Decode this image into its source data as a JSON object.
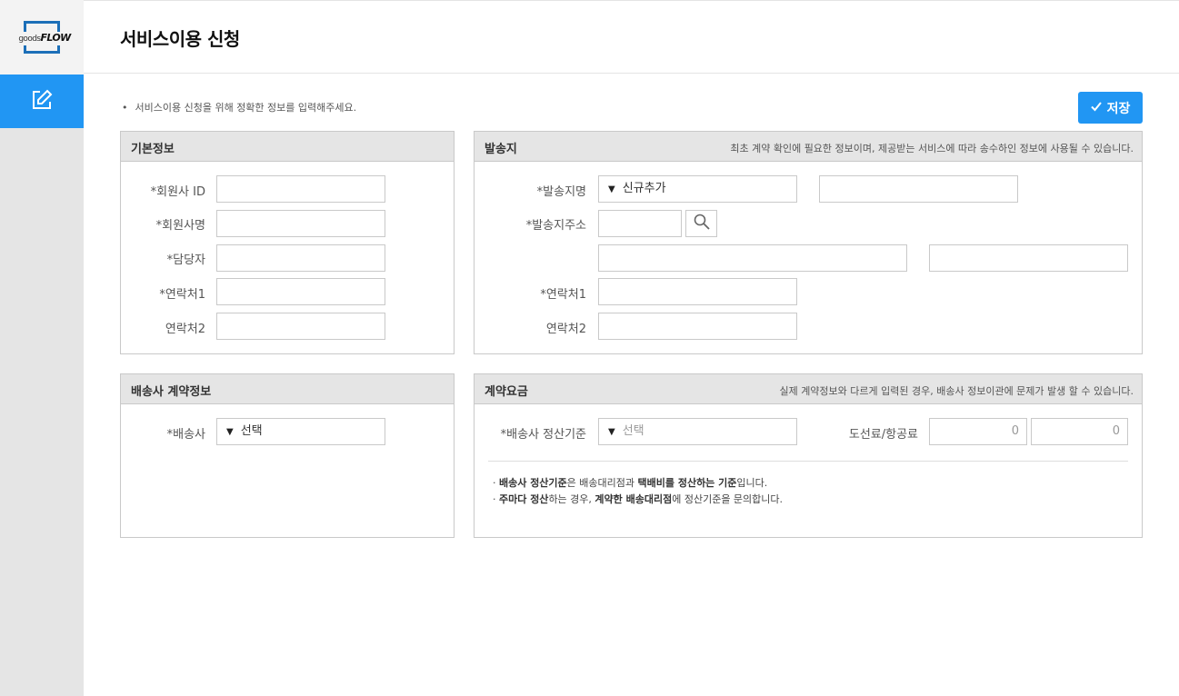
{
  "logo": {
    "prefix": "goods",
    "name": "FLOW"
  },
  "header": {
    "title": "서비스이용 신청"
  },
  "notice": "서비스이용 신청을 위해 정확한 정보를 입력해주세요.",
  "toolbar": {
    "save_label": "저장"
  },
  "basic": {
    "title": "기본정보",
    "labels": [
      "*회원사 ID",
      "*회원사명",
      "*담당자",
      "*연락처1",
      "연락처2"
    ]
  },
  "shipping": {
    "title": "발송지",
    "note": "최초 계약 확인에 필요한 정보이며, 제공받는 서비스에 따라 송수하인 정보에 사용될 수 있습니다.",
    "name_label": "*발송지명",
    "name_select": "신규추가",
    "addr_label": "*발송지주소",
    "phone1_label": "*연락처1",
    "phone2_label": "연락처2"
  },
  "carrier": {
    "title": "배송사 계약정보",
    "carrier_label": "*배송사",
    "carrier_select": "선택"
  },
  "fee": {
    "title": "계약요금",
    "note": "실제 계약정보와 다르게 입력된 경우, 배송사 정보이관에 문제가 발생 할 수 있습니다.",
    "basis_label": "*배송사 정산기준",
    "basis_select": "선택",
    "island_label": "도선료/항공료",
    "island_values": [
      "0",
      "0"
    ],
    "info1": {
      "prefix": "· ",
      "b1": "배송사 정산기준",
      "t1": "은 배송대리점과 ",
      "b2": "택배비를 정산하는 기준",
      "t2": "입니다."
    },
    "info2": {
      "prefix": "· ",
      "b1": "주마다 정산",
      "t1": "하는 경우, ",
      "b2": "계약한 배송대리점",
      "t2": "에 정산기준을 문의합니다."
    }
  },
  "colors": {
    "accent": "#2196f3",
    "sidebar": "#e5e5e5",
    "panel_head": "#e5e5e5",
    "logo_blue": "#1c6fb8"
  }
}
